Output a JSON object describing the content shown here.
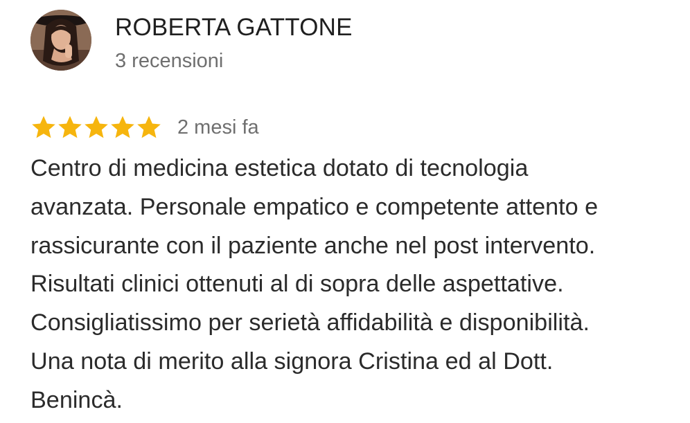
{
  "reviewer": {
    "name": "ROBERTA GATTONE",
    "review_count": "3 recensioni",
    "avatar": "profile-photo"
  },
  "review": {
    "rating": 5,
    "rating_max": 5,
    "star_icon": "star-icon",
    "star_color": "#f6b50e",
    "date": "2 mesi fa",
    "lines": [
      "Centro di medicina estetica dotato di tecnologia",
      "avanzata. Personale empatico e competente attento e",
      "rassicurante con il paziente anche nel post intervento.",
      "Risultati clinici ottenuti al di sopra delle aspettative.",
      "Consigliatissimo per serietà affidabilità e disponibilità.",
      "Una nota di merito alla signora Cristina ed al Dott.",
      "Benincà."
    ]
  }
}
